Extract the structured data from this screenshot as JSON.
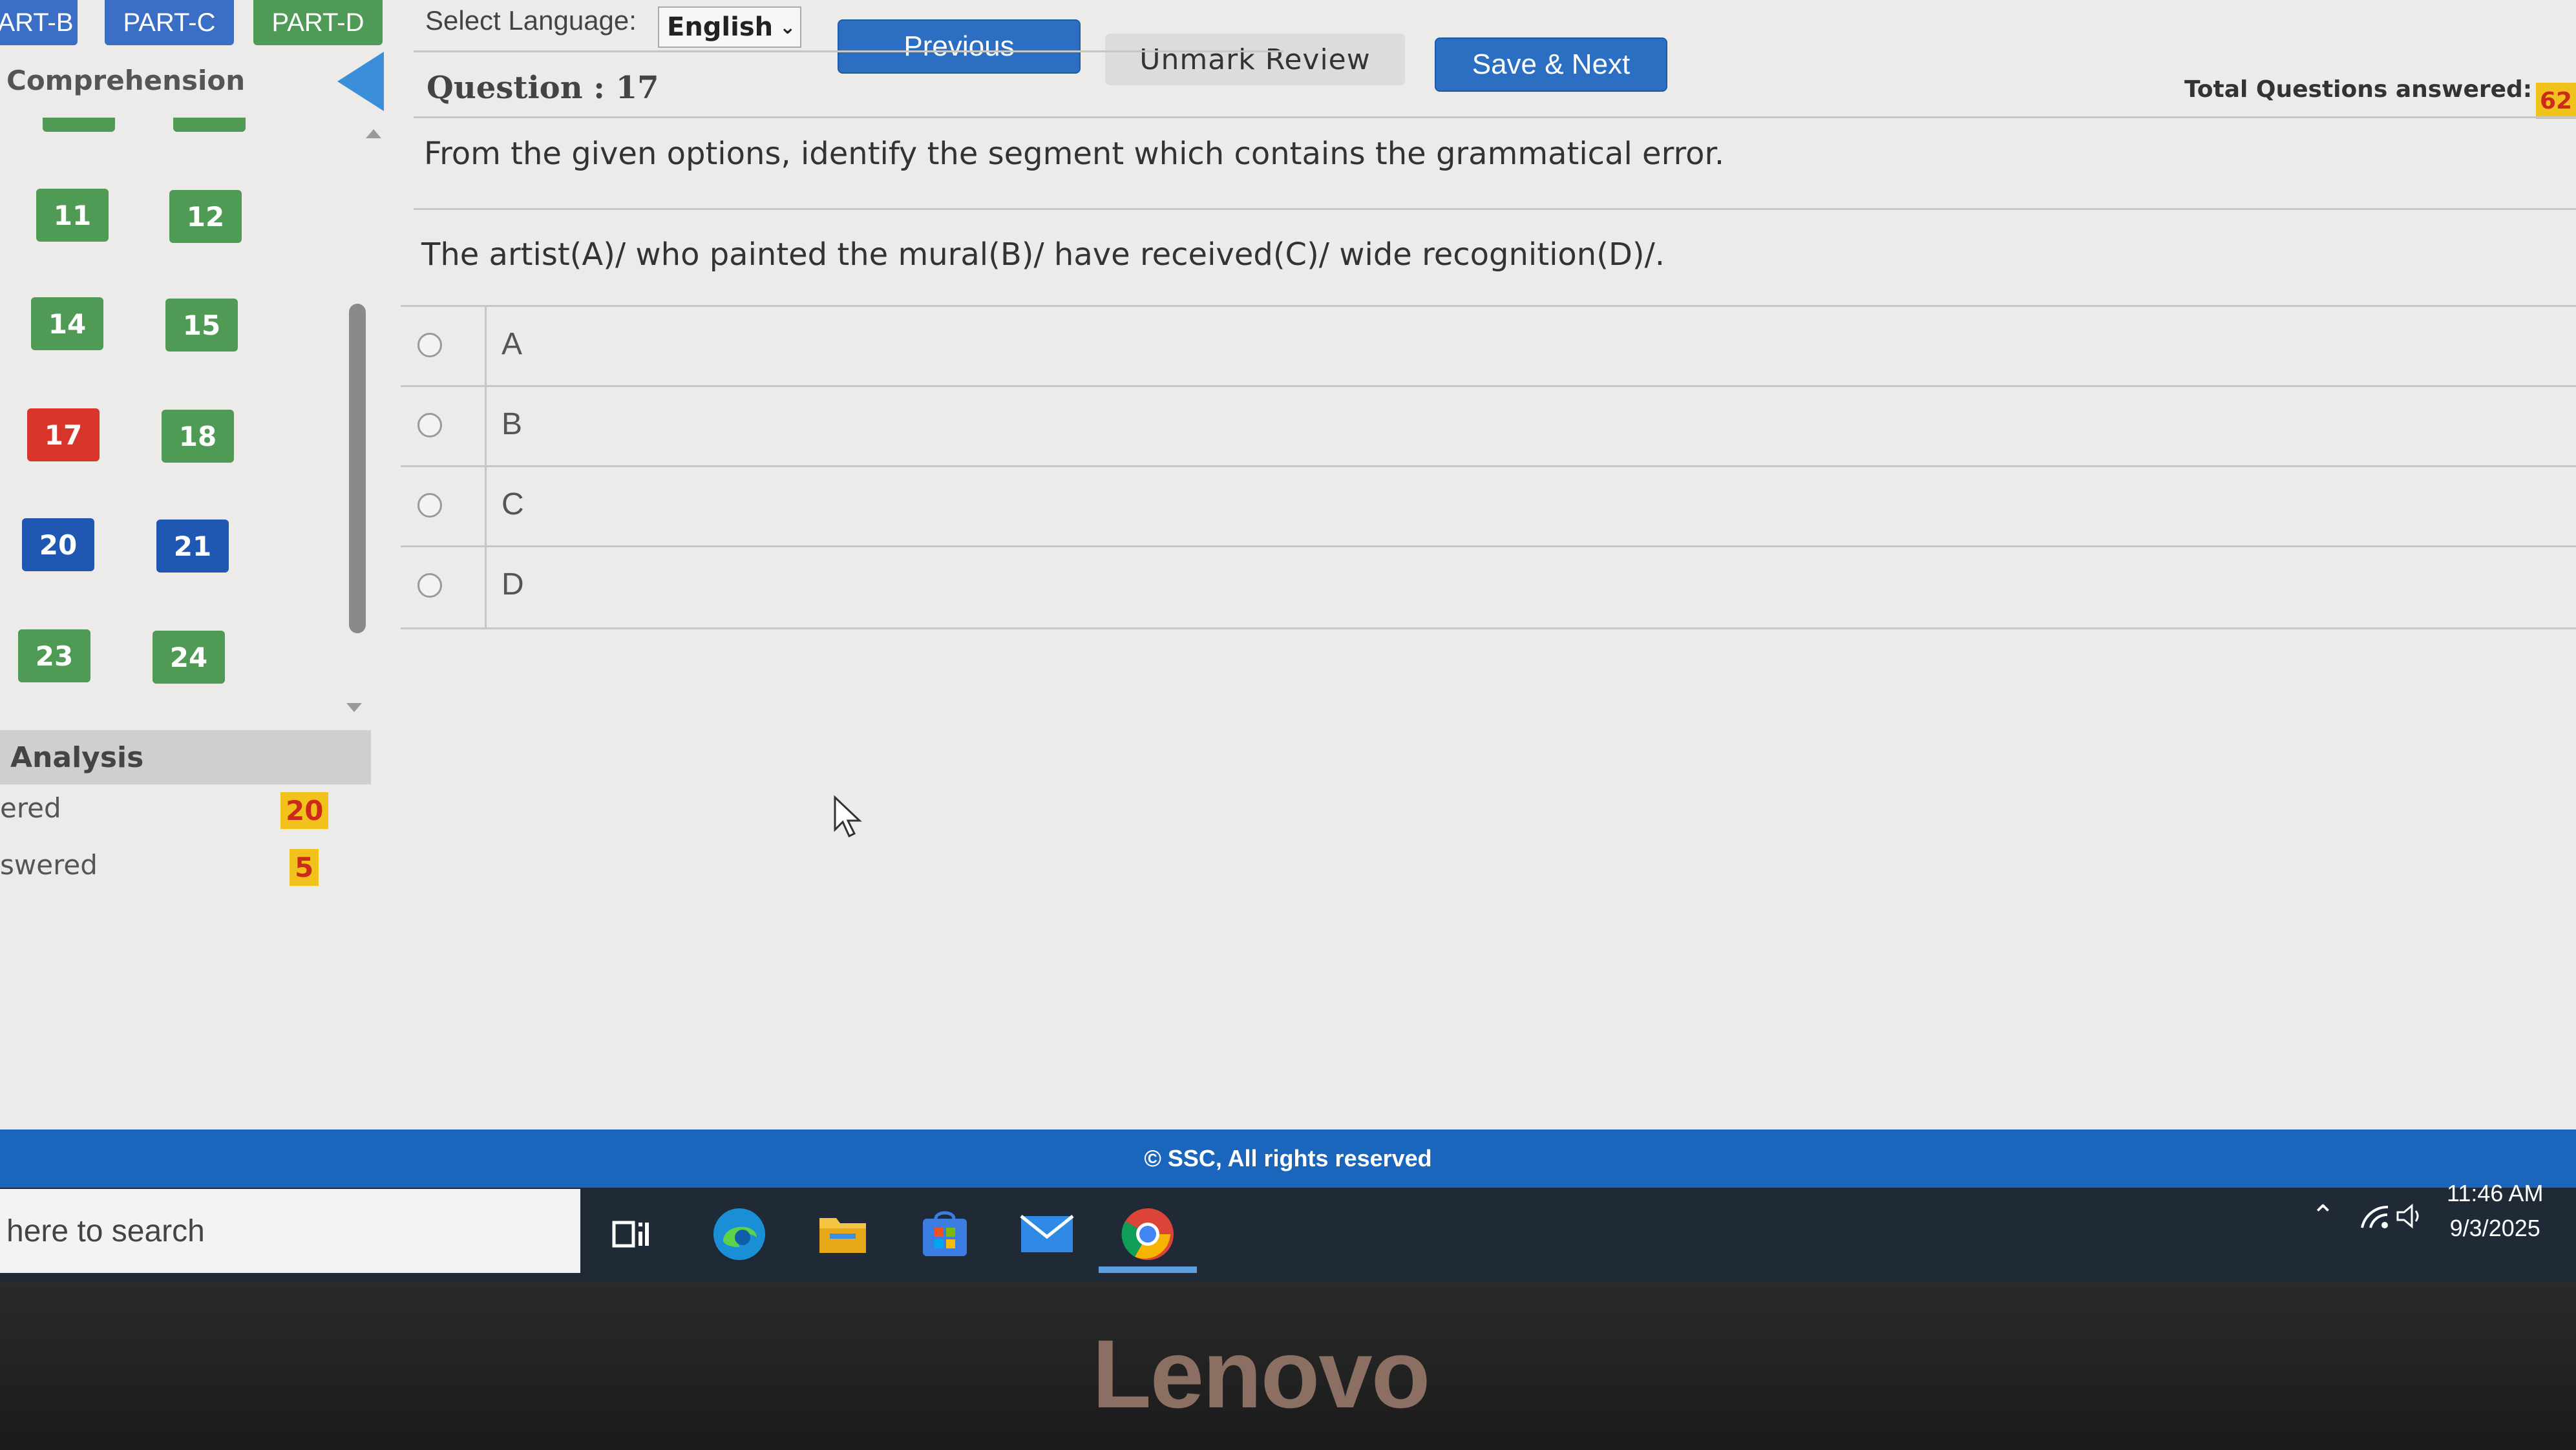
{
  "tabs": [
    {
      "label": "ART-B",
      "active": false
    },
    {
      "label": "PART-C",
      "active": false
    },
    {
      "label": "PART-D",
      "active": true
    }
  ],
  "language": {
    "label": "Select Language:",
    "selected": "English"
  },
  "toolbar": {
    "previous_label": "Previous",
    "unmark_label": "Unmark Review",
    "save_next_label": "Save & Next"
  },
  "total": {
    "label": "Total Questions answered:",
    "value": "62"
  },
  "sidebar": {
    "section_title": "Comprehension",
    "questions": [
      {
        "num": "11",
        "status": "answered"
      },
      {
        "num": "12",
        "status": "answered"
      },
      {
        "num": "14",
        "status": "answered"
      },
      {
        "num": "15",
        "status": "answered"
      },
      {
        "num": "17",
        "status": "current"
      },
      {
        "num": "18",
        "status": "answered"
      },
      {
        "num": "20",
        "status": "marked"
      },
      {
        "num": "21",
        "status": "marked"
      },
      {
        "num": "23",
        "status": "answered"
      },
      {
        "num": "24",
        "status": "answered"
      }
    ],
    "analysis": {
      "title": "Analysis",
      "rows": [
        {
          "label": "ered",
          "value": "20"
        },
        {
          "label": "swered",
          "value": "5"
        }
      ]
    }
  },
  "question": {
    "title": "Question : 17",
    "instruction": "From the given options, identify the segment which contains the grammatical error.",
    "sentence": "The artist(A)/ who painted the mural(B)/ have received(C)/ wide recognition(D)/.",
    "options": [
      "A",
      "B",
      "C",
      "D"
    ]
  },
  "footer": {
    "copyright": "© SSC, All rights reserved"
  },
  "taskbar": {
    "search_placeholder": "here to search",
    "icons": [
      "task-view-icon",
      "edge-icon",
      "file-explorer-icon",
      "store-icon",
      "mail-icon",
      "chrome-icon"
    ],
    "time": "11:46 AM",
    "date": "9/3/2025"
  },
  "monitor": {
    "brand": "Lenovo"
  },
  "colors": {
    "answered": "#4f9a54",
    "current": "#d8362b",
    "marked": "#1f57b3",
    "accent": "#2c6fc2",
    "footer": "#1a66bd"
  }
}
